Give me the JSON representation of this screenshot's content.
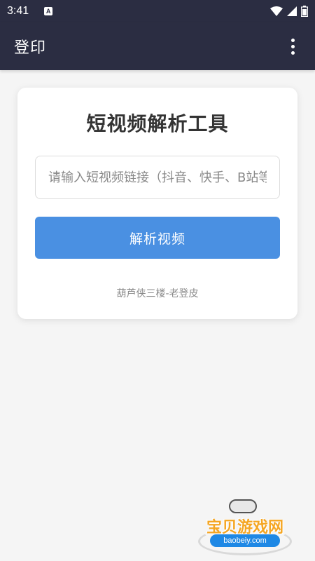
{
  "status_bar": {
    "time": "3:41",
    "notification_icon": "a-icon",
    "icons": [
      "wifi-icon",
      "signal-icon",
      "battery-icon"
    ]
  },
  "app_bar": {
    "title": "登印",
    "menu_icon": "more-vert-icon"
  },
  "card": {
    "title": "短视频解析工具",
    "input": {
      "value": "",
      "placeholder": "请输入短视频链接（抖音、快手、B站等）"
    },
    "button_label": "解析视频",
    "footer": "葫芦侠三楼-老登皮"
  },
  "watermark": {
    "text": "宝贝游戏网",
    "url": "baobeiy.com"
  },
  "colors": {
    "app_bar": "#2b2d42",
    "background": "#f5f5f5",
    "primary_button": "#4a90e2",
    "title_text": "#333333",
    "footer_text": "#8a8a8a"
  }
}
